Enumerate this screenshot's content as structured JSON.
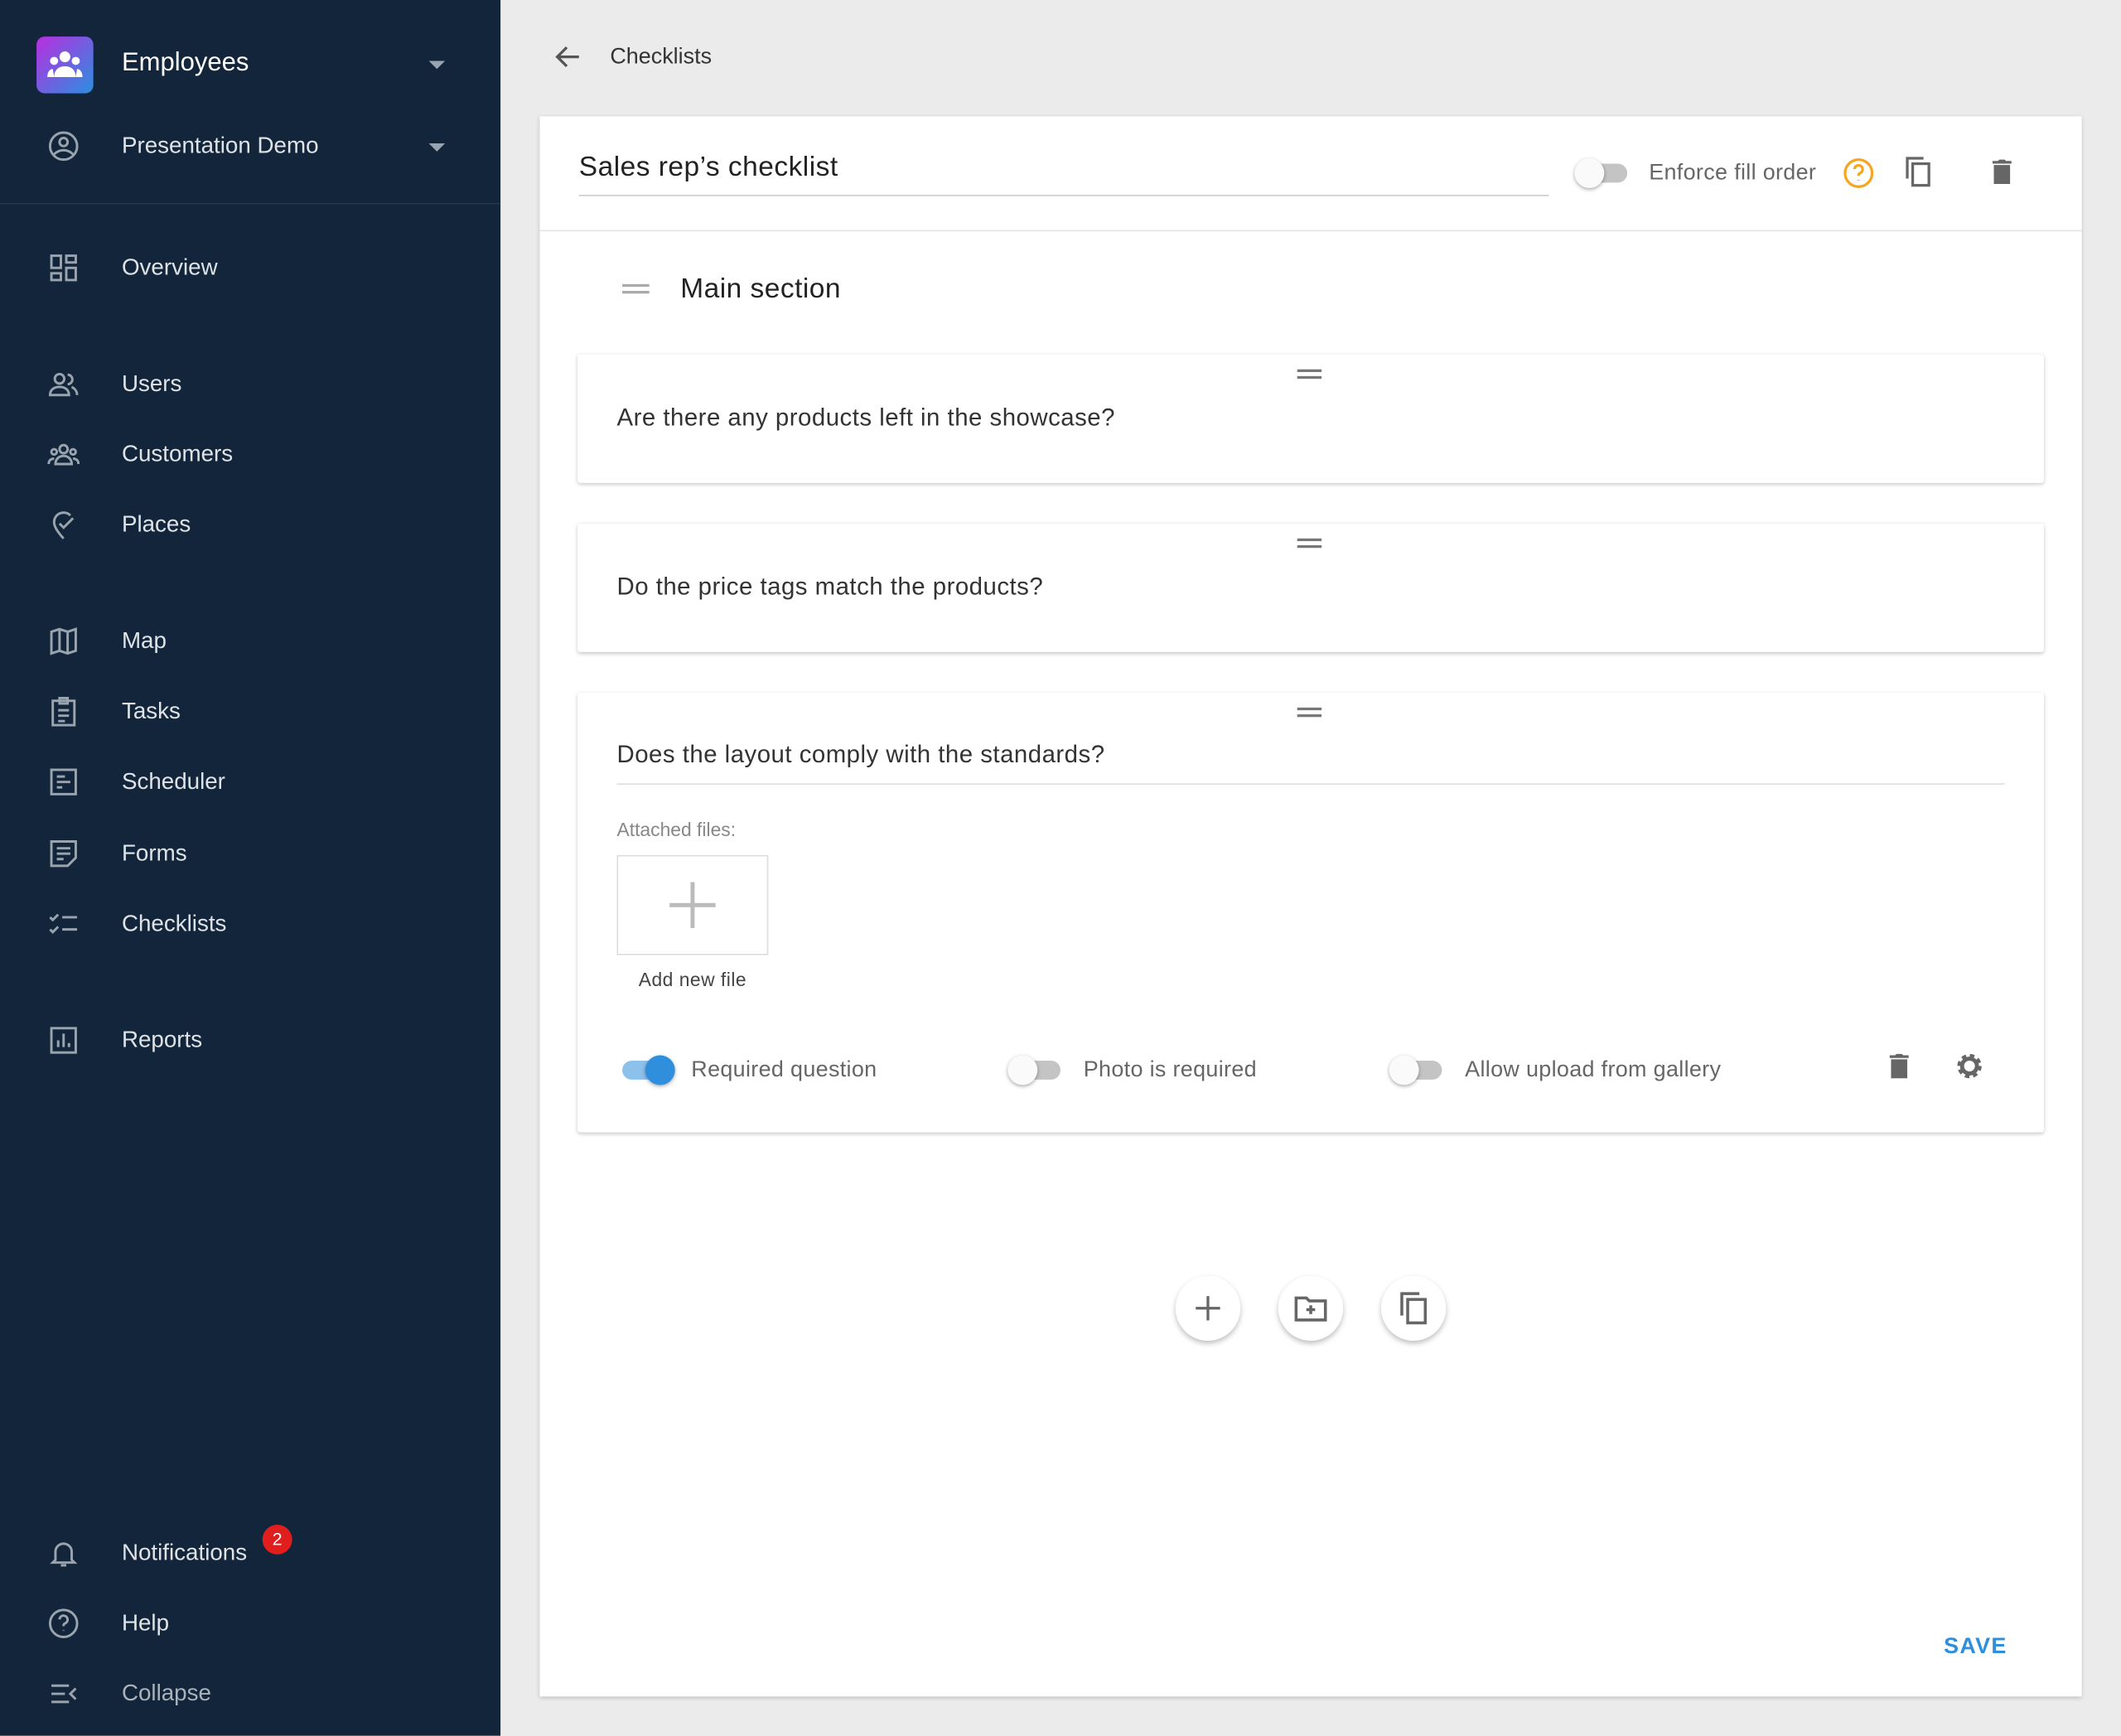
{
  "sidebar": {
    "app_name": "Employees",
    "account": "Presentation Demo",
    "items": [
      {
        "label": "Overview",
        "icon": "dashboard-icon"
      },
      {
        "label": "Users",
        "icon": "users-icon"
      },
      {
        "label": "Customers",
        "icon": "customers-icon"
      },
      {
        "label": "Places",
        "icon": "place-icon"
      },
      {
        "label": "Map",
        "icon": "map-icon"
      },
      {
        "label": "Tasks",
        "icon": "tasks-icon"
      },
      {
        "label": "Scheduler",
        "icon": "scheduler-icon"
      },
      {
        "label": "Forms",
        "icon": "forms-icon"
      },
      {
        "label": "Checklists",
        "icon": "checklist-icon"
      },
      {
        "label": "Reports",
        "icon": "reports-icon"
      }
    ],
    "notifications": {
      "label": "Notifications",
      "badge": "2"
    },
    "help": "Help",
    "collapse": "Collapse"
  },
  "header": {
    "breadcrumb": "Checklists"
  },
  "checklist": {
    "title": "Sales rep’s checklist",
    "enforce_fill_order": {
      "label": "Enforce fill order",
      "on": false
    },
    "section_title": "Main section",
    "questions": [
      {
        "text": "Are there any products left in the showcase?"
      },
      {
        "text": "Do the price tags match the products?"
      },
      {
        "text": "Does the layout comply with the standards?"
      }
    ],
    "attached_files_label": "Attached files:",
    "add_file_label": "Add new file",
    "options": {
      "required_question": {
        "label": "Required question",
        "on": true
      },
      "photo_required": {
        "label": "Photo is required",
        "on": false
      },
      "allow_gallery": {
        "label": "Allow upload from gallery",
        "on": false
      }
    },
    "save_label": "SAVE"
  },
  "colors": {
    "sidebar": "#13253a",
    "accent": "#2f8fdc",
    "help_icon": "#f5a623",
    "badge": "#e01e1e"
  }
}
